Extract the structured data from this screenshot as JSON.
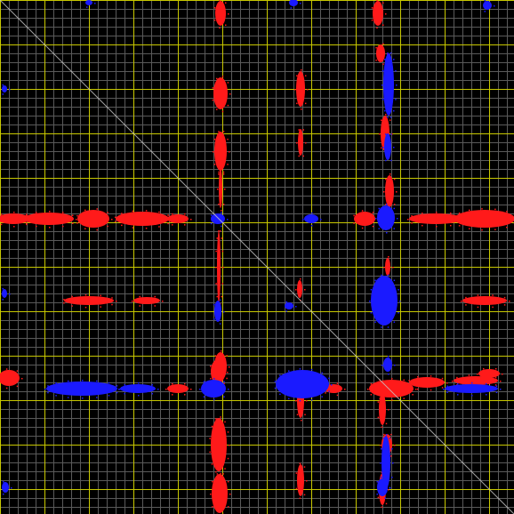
{
  "chart_data": {
    "type": "heatmap",
    "x": {
      "min": 0,
      "max": 578,
      "minor_step": 10,
      "major_step": 50
    },
    "y": {
      "min": 0,
      "max": 578,
      "minor_step": 10,
      "major_step": 50
    },
    "grid": true,
    "diagonal": true,
    "colors": {
      "background": "#000000",
      "minor_grid": "#5a5a5a",
      "major_grid": "#c8c800",
      "diagonal": "#c8c8c8",
      "positive": "#ff1a1a",
      "negative": "#1a1aff"
    },
    "series": [
      {
        "name": "",
        "color_key": "positive",
        "blobs": [
          [
            248,
            15,
            6,
            14
          ],
          [
            248,
            105,
            8,
            18
          ],
          [
            248,
            170,
            7,
            22
          ],
          [
            248,
            212,
            2,
            22
          ],
          [
            246,
            300,
            2,
            40
          ],
          [
            248,
            412,
            7,
            16
          ],
          [
            246,
            500,
            9,
            30
          ],
          [
            247,
            555,
            9,
            22
          ],
          [
            338,
            100,
            5,
            20
          ],
          [
            338,
            160,
            3,
            15
          ],
          [
            337,
            325,
            3,
            10
          ],
          [
            338,
            450,
            4,
            20
          ],
          [
            338,
            540,
            4,
            18
          ],
          [
            425,
            15,
            6,
            14
          ],
          [
            428,
            60,
            5,
            10
          ],
          [
            433,
            150,
            5,
            20
          ],
          [
            438,
            215,
            5,
            18
          ],
          [
            436,
            300,
            3,
            10
          ],
          [
            430,
            460,
            4,
            18
          ],
          [
            435,
            500,
            6,
            12
          ],
          [
            430,
            550,
            4,
            18
          ],
          [
            15,
            246,
            18,
            6
          ],
          [
            55,
            246,
            28,
            7
          ],
          [
            105,
            246,
            18,
            10
          ],
          [
            160,
            246,
            30,
            8
          ],
          [
            200,
            246,
            12,
            5
          ],
          [
            410,
            246,
            12,
            8
          ],
          [
            490,
            246,
            30,
            6
          ],
          [
            545,
            246,
            34,
            10
          ],
          [
            100,
            338,
            28,
            5
          ],
          [
            165,
            338,
            15,
            4
          ],
          [
            545,
            338,
            25,
            5
          ],
          [
            10,
            425,
            12,
            9
          ],
          [
            200,
            437,
            12,
            5
          ],
          [
            245,
            418,
            8,
            14
          ],
          [
            375,
            437,
            10,
            5
          ],
          [
            440,
            437,
            25,
            10
          ],
          [
            480,
            430,
            20,
            6
          ],
          [
            535,
            428,
            25,
            5
          ],
          [
            550,
            420,
            12,
            5
          ]
        ]
      },
      {
        "name": "",
        "color_key": "negative",
        "blobs": [
          [
            100,
            3,
            4,
            3
          ],
          [
            330,
            3,
            5,
            4
          ],
          [
            548,
            6,
            5,
            5
          ],
          [
            5,
            100,
            3,
            4
          ],
          [
            5,
            330,
            3,
            5
          ],
          [
            6,
            548,
            4,
            6
          ],
          [
            437,
            95,
            6,
            35
          ],
          [
            436,
            165,
            4,
            15
          ],
          [
            434,
            245,
            10,
            14
          ],
          [
            432,
            338,
            15,
            28
          ],
          [
            436,
            410,
            5,
            8
          ],
          [
            434,
            520,
            5,
            30
          ],
          [
            430,
            548,
            6,
            10
          ],
          [
            245,
            246,
            8,
            6
          ],
          [
            350,
            246,
            8,
            5
          ],
          [
            240,
            437,
            14,
            10
          ],
          [
            340,
            432,
            30,
            16
          ],
          [
            92,
            437,
            40,
            8
          ],
          [
            155,
            437,
            20,
            5
          ],
          [
            530,
            437,
            30,
            5
          ],
          [
            245,
            350,
            4,
            12
          ],
          [
            325,
            344,
            5,
            4
          ]
        ]
      }
    ]
  }
}
